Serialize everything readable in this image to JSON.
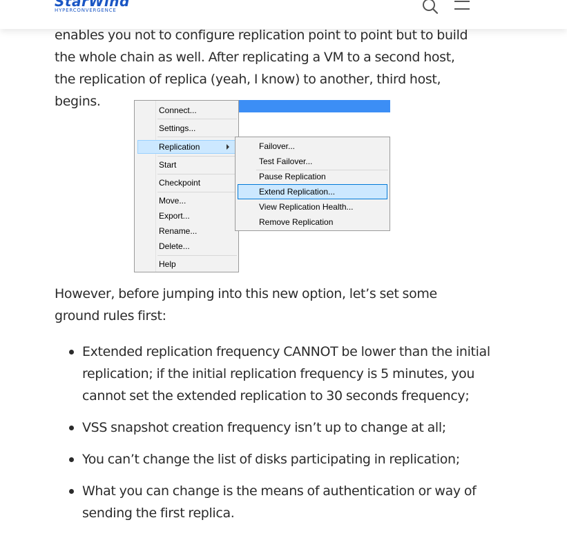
{
  "header": {
    "logo_text": "StarWind",
    "logo_subtext": "HYPERCONVERGENCE",
    "search_icon": "search-icon",
    "menu_icon": "hamburger-menu-icon"
  },
  "article": {
    "intro_text": "enables you not to configure replication point to point but to build the whole chain as well. After replicating a VM to a second host, the replication of replica (yeah, I know) to another, third host, begins.",
    "after_figure_text": "However, before jumping into this new option, let’s set some ground rules first:",
    "rules": [
      "Extended replication frequency CANNOT be lower than the initial replication; if the initial replication frequency is 5 minutes, you cannot set the extended replication to 30 seconds frequency;",
      "VSS snapshot creation frequency isn’t up to change at all;",
      "You can’t change the list of disks participating in replication;",
      "What you can change is the means of authentication or way of sending the first replica."
    ]
  },
  "figure": {
    "context_menu": [
      "Connect...",
      "Settings...",
      "Replication",
      "Start",
      "Checkpoint",
      "Move...",
      "Export...",
      "Rename...",
      "Delete...",
      "Help"
    ],
    "highlighted_item": "Replication",
    "submenu": [
      "Failover...",
      "Test Failover...",
      "Pause Replication",
      "Extend Replication...",
      "View Replication Health...",
      "Remove Replication"
    ],
    "highlighted_subitem": "Extend Replication...",
    "colors": {
      "titlebar": "#3c8ef5",
      "highlight_fill": "#cce8ff",
      "highlight_border": "#0078d7"
    }
  }
}
